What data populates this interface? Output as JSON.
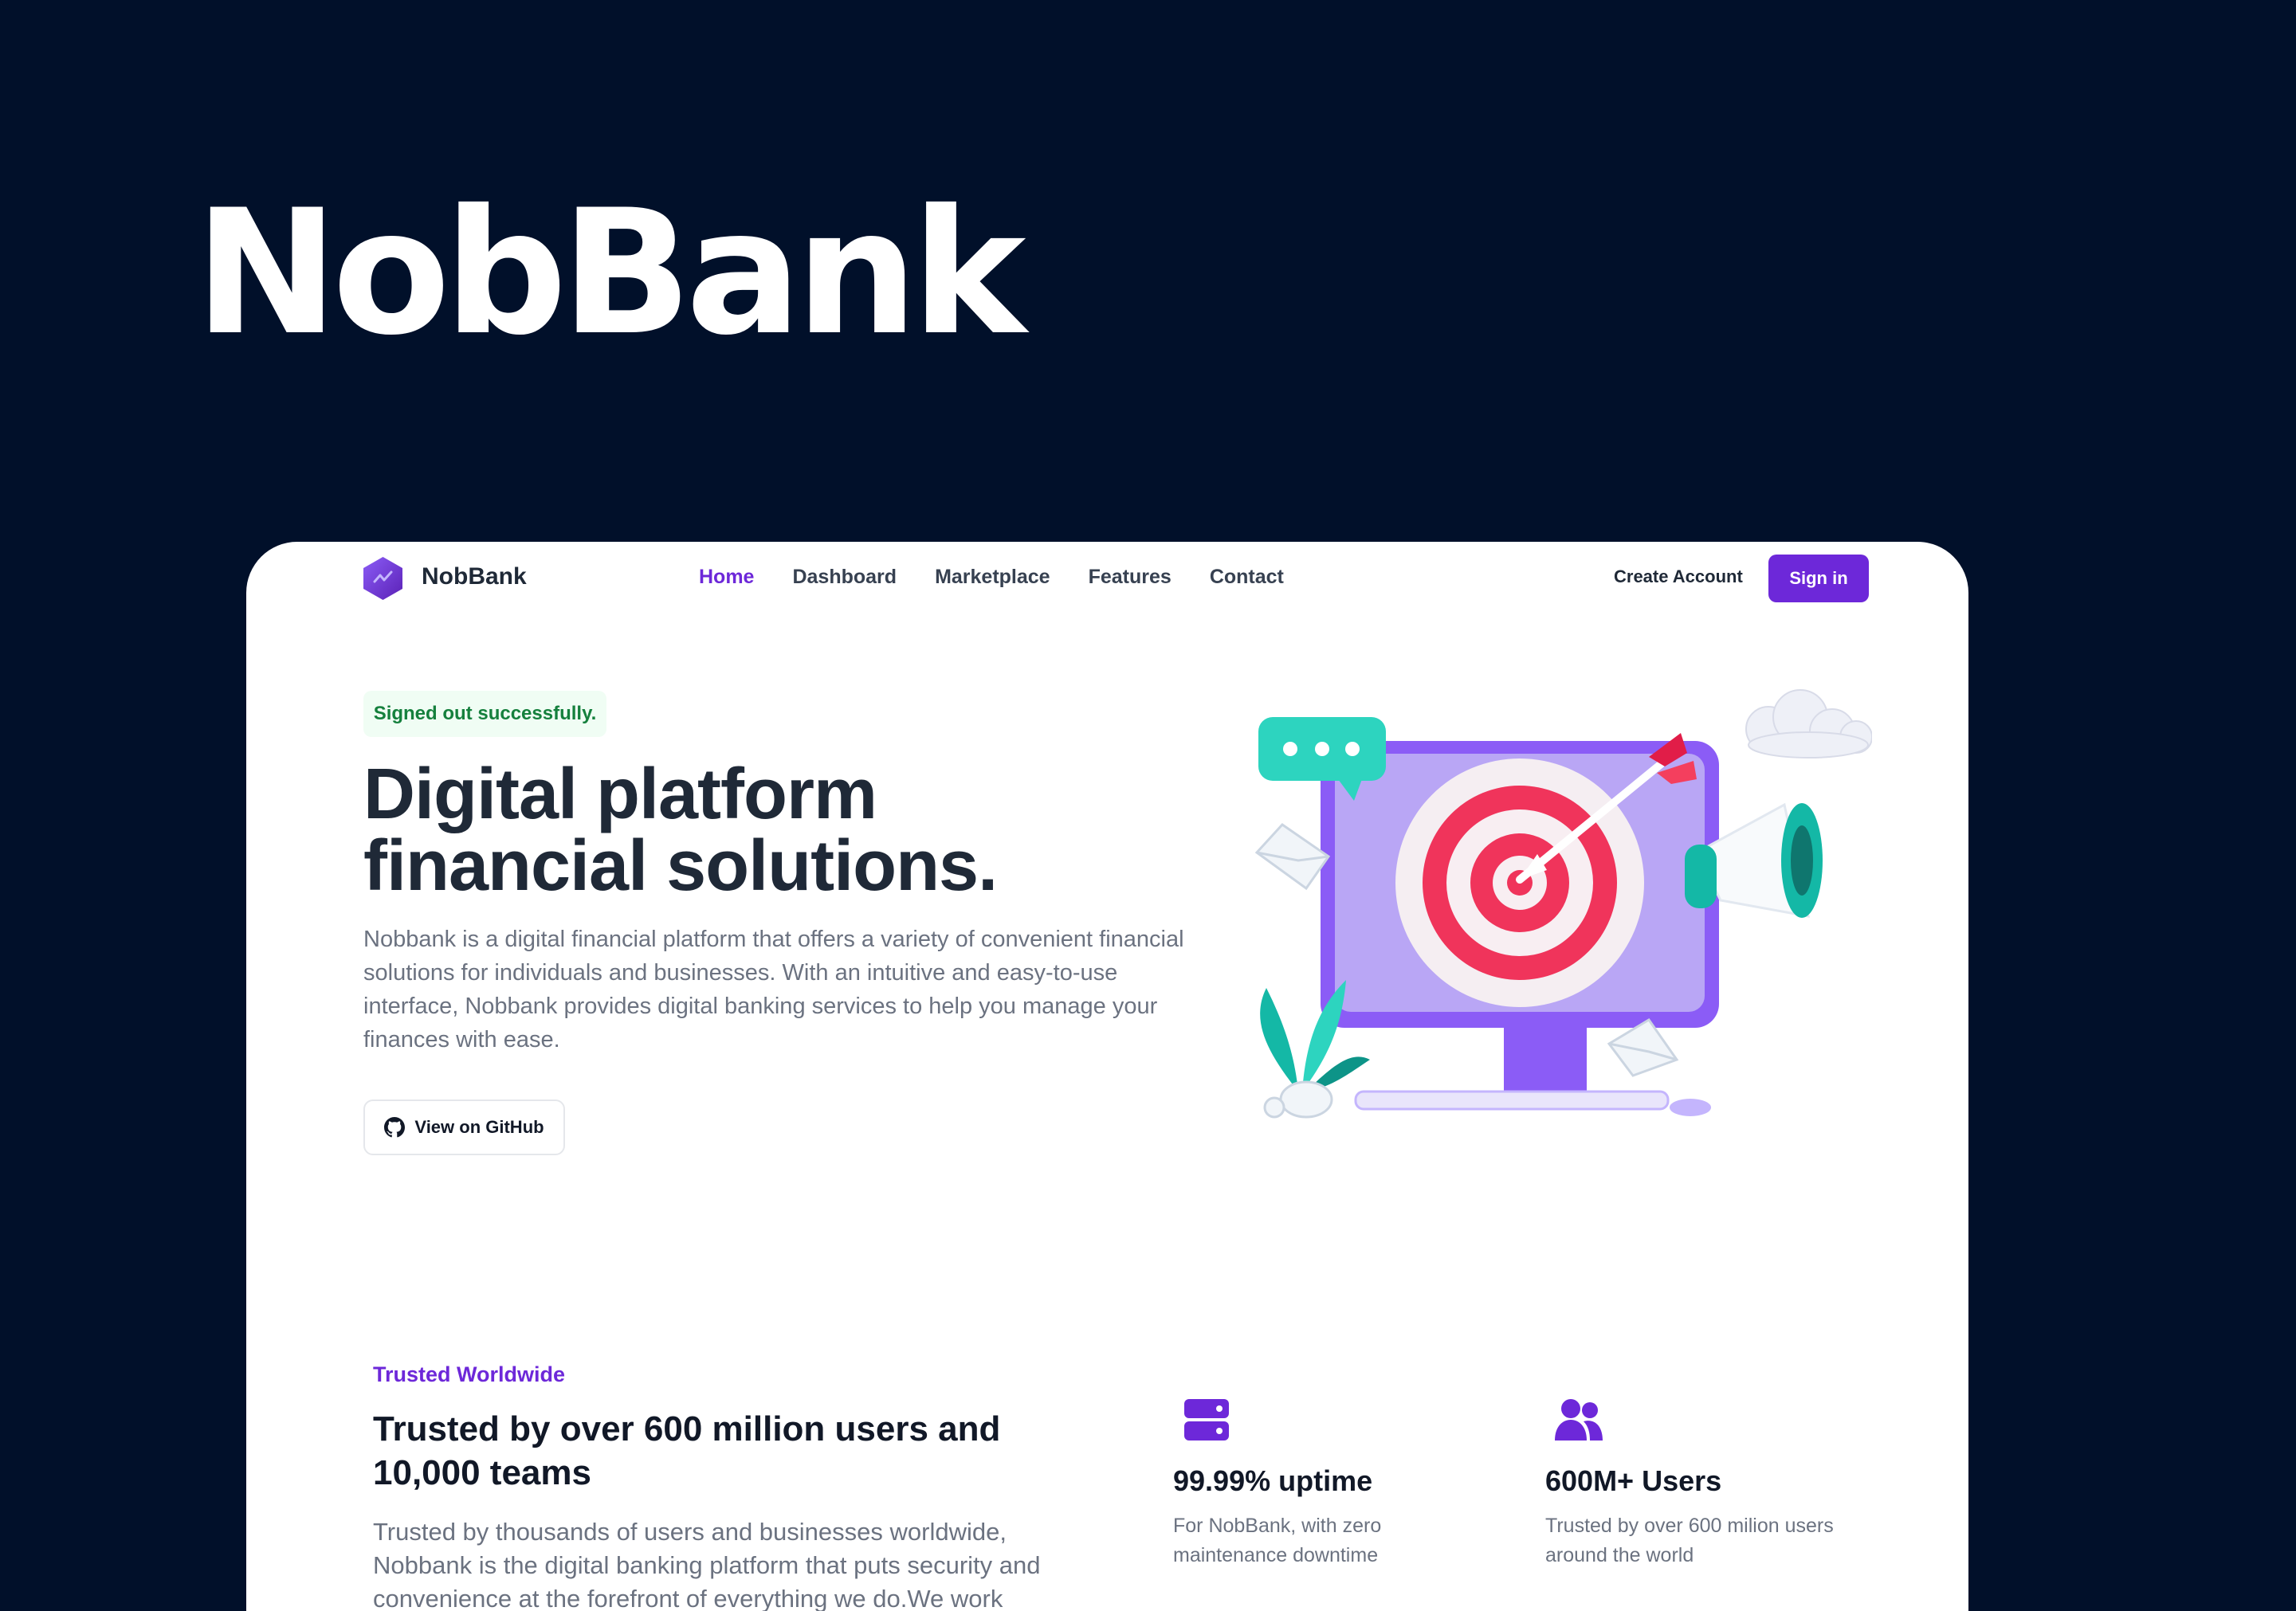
{
  "brand_heading": "NobBank",
  "colors": {
    "background": "#01102a",
    "accent": "#6d28d9",
    "alert_text": "#15803d",
    "alert_bg": "#f0fdf4"
  },
  "nav": {
    "logo_icon": "hexagon-logo-icon",
    "brand": "NobBank",
    "links": [
      {
        "label": "Home",
        "active": true
      },
      {
        "label": "Dashboard",
        "active": false
      },
      {
        "label": "Marketplace",
        "active": false
      },
      {
        "label": "Features",
        "active": false
      },
      {
        "label": "Contact",
        "active": false
      }
    ],
    "create_account": "Create Account",
    "sign_in": "Sign in"
  },
  "hero": {
    "alert": "Signed out successfully.",
    "title_line1": "Digital platform",
    "title_line2": "financial solutions.",
    "description": "Nobbank is a digital financial platform that offers a variety of convenient financial solutions for individuals and businesses. With an intuitive and easy-to-use interface, Nobbank provides digital banking services to help you manage your finances with ease.",
    "github_button": "View on GitHub",
    "illustration": "target-monitor-illustration"
  },
  "trusted": {
    "eyebrow": "Trusted Worldwide",
    "heading_line1": "Trusted by over 600 million users and",
    "heading_line2": "10,000 teams",
    "description": "Trusted by thousands of users and businesses worldwide, Nobbank is the digital banking platform that puts security and convenience at the forefront of everything we do.We work",
    "stats": [
      {
        "icon": "server-icon",
        "title": "99.99% uptime",
        "description": "For NobBank, with zero maintenance downtime"
      },
      {
        "icon": "users-icon",
        "title": "600M+ Users",
        "description": "Trusted by over 600 milion users around the world"
      }
    ]
  }
}
